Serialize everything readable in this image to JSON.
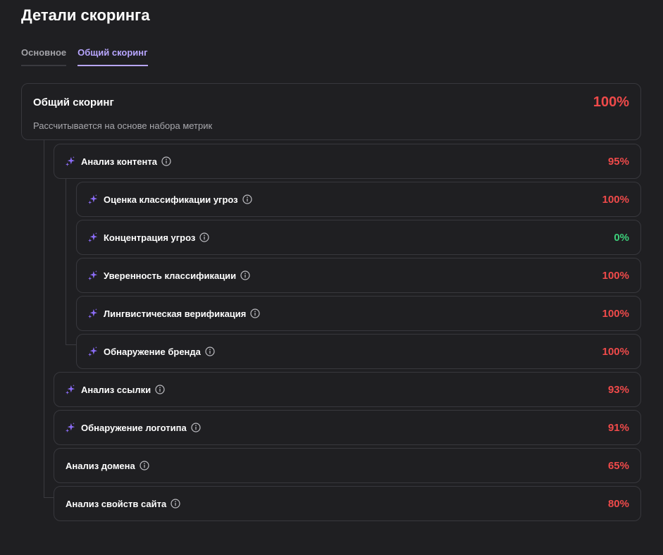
{
  "page": {
    "title": "Детали скоринга"
  },
  "tabs": [
    {
      "label": "Основное",
      "active": false
    },
    {
      "label": "Общий скоринг",
      "active": true
    }
  ],
  "overall": {
    "title": "Общий скоринг",
    "description": "Рассчитывается на основе набора метрик",
    "value": "100%"
  },
  "metrics": {
    "content": {
      "label": "Анализ контента",
      "value": "95%",
      "ai": true
    },
    "threat_classification": {
      "label": "Оценка классификации угроз",
      "value": "100%",
      "ai": true
    },
    "threat_concentration": {
      "label": "Концентрация угроз",
      "value": "0%",
      "ai": true
    },
    "classification_confidence": {
      "label": "Уверенность классификации",
      "value": "100%",
      "ai": true
    },
    "linguistic_verification": {
      "label": "Лингвистическая верификация",
      "value": "100%",
      "ai": true
    },
    "brand_detection": {
      "label": "Обнаружение бренда",
      "value": "100%",
      "ai": true
    },
    "link_analysis": {
      "label": "Анализ ссылки",
      "value": "93%",
      "ai": true
    },
    "logo_detection": {
      "label": "Обнаружение логотипа",
      "value": "91%",
      "ai": true
    },
    "domain_analysis": {
      "label": "Анализ домена",
      "value": "65%",
      "ai": false
    },
    "site_properties": {
      "label": "Анализ свойств сайта",
      "value": "80%",
      "ai": false
    }
  },
  "colors": {
    "background": "#1f1f22",
    "card_border": "#38383d",
    "accent": "#b8a6ff",
    "sparkle": "#8b6cf6",
    "score_high": "#ef4a4a",
    "score_low": "#3ccf7a"
  },
  "icons": {
    "ai": "sparkle-icon",
    "info": "info-icon"
  }
}
